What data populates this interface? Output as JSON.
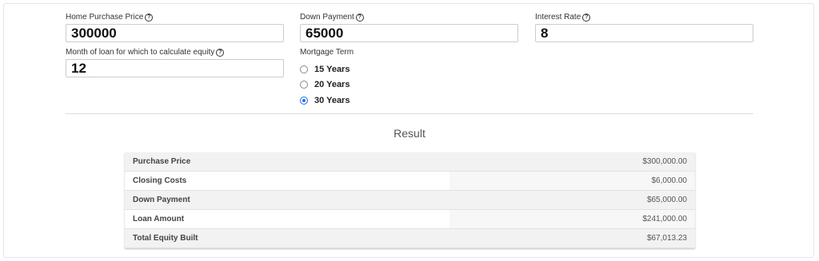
{
  "fields": {
    "home_price": {
      "label": "Home Purchase Price",
      "value": "300000"
    },
    "down_payment": {
      "label": "Down Payment",
      "value": "65000"
    },
    "interest_rate": {
      "label": "Interest Rate",
      "value": "8"
    },
    "equity_month": {
      "label": "Month of loan for which to calculate equity",
      "value": "12"
    }
  },
  "help_glyph": "?",
  "mortgage_term": {
    "label": "Mortgage Term",
    "options": [
      "15 Years",
      "20 Years",
      "30 Years"
    ],
    "selected": "30 Years"
  },
  "result": {
    "title": "Result",
    "rows": [
      {
        "label": "Purchase Price",
        "value": "$300,000.00"
      },
      {
        "label": "Closing Costs",
        "value": "$6,000.00"
      },
      {
        "label": "Down Payment",
        "value": "$65,000.00"
      },
      {
        "label": "Loan Amount",
        "value": "$241,000.00"
      },
      {
        "label": "Total Equity Built",
        "value": "$67,013.23"
      }
    ]
  },
  "colors": {
    "accent": "#1a73e8",
    "row_shade": "#f2f2f2",
    "border": "#cccccc"
  }
}
